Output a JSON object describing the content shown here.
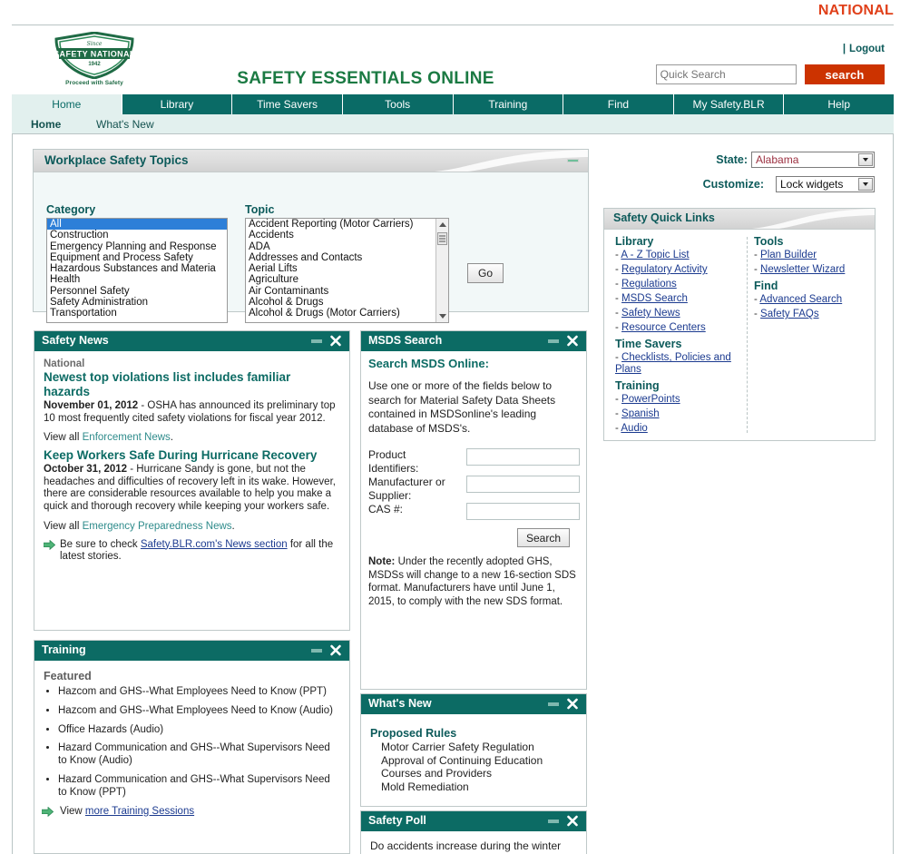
{
  "top": {
    "national_label": "NATIONAL",
    "accent_color": "#E0401A"
  },
  "header": {
    "logo": {
      "shield_line1": "SAFETY NATIONAL",
      "shield_since": "Since",
      "shield_year": "1942",
      "tagline": "Proceed with Safety"
    },
    "site_title": "SAFETY ESSENTIALS ONLINE",
    "divider": "|",
    "logout_label": "Logout",
    "search_placeholder": "Quick Search",
    "search_value": "",
    "search_button": "search",
    "brand_green": "#1B7A43",
    "search_button_color": "#CC3300"
  },
  "nav": {
    "tabs": [
      {
        "label": "Home",
        "active": true
      },
      {
        "label": "Library",
        "active": false
      },
      {
        "label": "Time Savers",
        "active": false
      },
      {
        "label": "Tools",
        "active": false
      },
      {
        "label": "Training",
        "active": false
      },
      {
        "label": "Find",
        "active": false
      },
      {
        "label": "My Safety.BLR",
        "active": false
      },
      {
        "label": "Help",
        "active": false
      }
    ],
    "teal": "#0A6B66"
  },
  "subnav": {
    "home": "Home",
    "whats_new": "What's New"
  },
  "workplace_safety_topics": {
    "title": "Workplace Safety Topics",
    "category_label": "Category",
    "topic_label": "Topic",
    "categories": [
      "All",
      "Construction",
      "Emergency Planning and Response",
      "Equipment and Process Safety",
      "Hazardous Substances and Materia",
      "Health",
      "Personnel Safety",
      "Safety Administration",
      "Transportation"
    ],
    "selected_category": "All",
    "topics": [
      "Accident Reporting (Motor Carriers)",
      "Accidents",
      "ADA",
      "Addresses and Contacts",
      "Aerial Lifts",
      "Agriculture",
      "Air Contaminants",
      "Alcohol & Drugs",
      "Alcohol & Drugs (Motor Carriers)"
    ],
    "go_button": "Go"
  },
  "controls": {
    "state_label": "State:",
    "state_value": "Alabama",
    "customize_label": "Customize:",
    "customize_value": "Lock widgets"
  },
  "quick_links": {
    "title": "Safety Quick Links",
    "left_groups": [
      {
        "heading": "Library",
        "items": [
          "A - Z Topic List",
          "Regulatory Activity",
          "Regulations",
          "MSDS Search",
          "Safety News",
          "Resource Centers"
        ]
      },
      {
        "heading": "Time Savers",
        "items": [
          "Checklists, Policies and Plans"
        ]
      },
      {
        "heading": "Training",
        "items": [
          "PowerPoints",
          "Spanish",
          "Audio"
        ]
      }
    ],
    "right_groups": [
      {
        "heading": "Tools",
        "items": [
          "Plan Builder",
          "Newsletter Wizard"
        ]
      },
      {
        "heading": "Find",
        "items": [
          "Advanced Search",
          "Safety FAQs"
        ]
      }
    ]
  },
  "safety_news": {
    "title": "Safety News",
    "category": "National",
    "articles": [
      {
        "headline": "Newest top violations list includes familiar hazards",
        "date": "November 01, 2012",
        "body": " - OSHA has announced its preliminary top 10 most frequently cited safety violations for fiscal year 2012.",
        "viewall_prefix": "View all ",
        "viewall_link": "Enforcement News",
        "viewall_suffix": "."
      },
      {
        "headline": "Keep Workers Safe During Hurricane Recovery",
        "date": "October 31, 2012",
        "body": " - Hurricane Sandy is gone, but not the headaches and difficulties of recovery left in its wake. However, there are considerable resources available to help you make a quick and thorough recovery while keeping your workers safe.",
        "viewall_prefix": "View all ",
        "viewall_link": "Emergency Preparedness News",
        "viewall_suffix": "."
      }
    ],
    "footer_prefix": "Be sure to check ",
    "footer_link": "Safety.BLR.com's News section",
    "footer_suffix": " for all the latest stories."
  },
  "msds": {
    "title": "MSDS Search",
    "heading": "Search MSDS Online:",
    "intro": "Use one or more of the fields below to search for Material Safety Data Sheets contained in MSDSonline's leading database of MSDS's.",
    "fields": [
      {
        "label": "Product Identifiers:",
        "value": ""
      },
      {
        "label": "Manufacturer or Supplier:",
        "value": ""
      },
      {
        "label": "CAS #:",
        "value": ""
      }
    ],
    "search_button": "Search",
    "note_label": "Note:",
    "note_text": " Under the recently adopted GHS, MSDSs will change to a new 16-section SDS format. Manufacturers have until June 1, 2015, to comply with the new SDS format."
  },
  "training": {
    "title": "Training",
    "featured_label": "Featured",
    "items": [
      "Hazcom and GHS--What Employees Need to Know (PPT)",
      "Hazcom and GHS--What Employees Need to Know (Audio)",
      "Office Hazards (Audio)",
      "Hazard Communication and GHS--What Supervisors Need to Know (Audio)",
      "Hazard Communication and GHS--What Supervisors Need to Know (PPT)"
    ],
    "footer_prefix": "View ",
    "footer_link": "more Training Sessions"
  },
  "whats_new": {
    "title": "What's New",
    "group_heading": "Proposed Rules",
    "items": [
      "Motor Carrier Safety Regulation",
      "Approval of Continuing Education Courses and Providers",
      "Mold Remediation"
    ]
  },
  "safety_poll": {
    "title": "Safety Poll",
    "question": "Do accidents increase during the winter"
  },
  "icons": {
    "minimize": "minimize-icon",
    "close": "close-icon"
  }
}
